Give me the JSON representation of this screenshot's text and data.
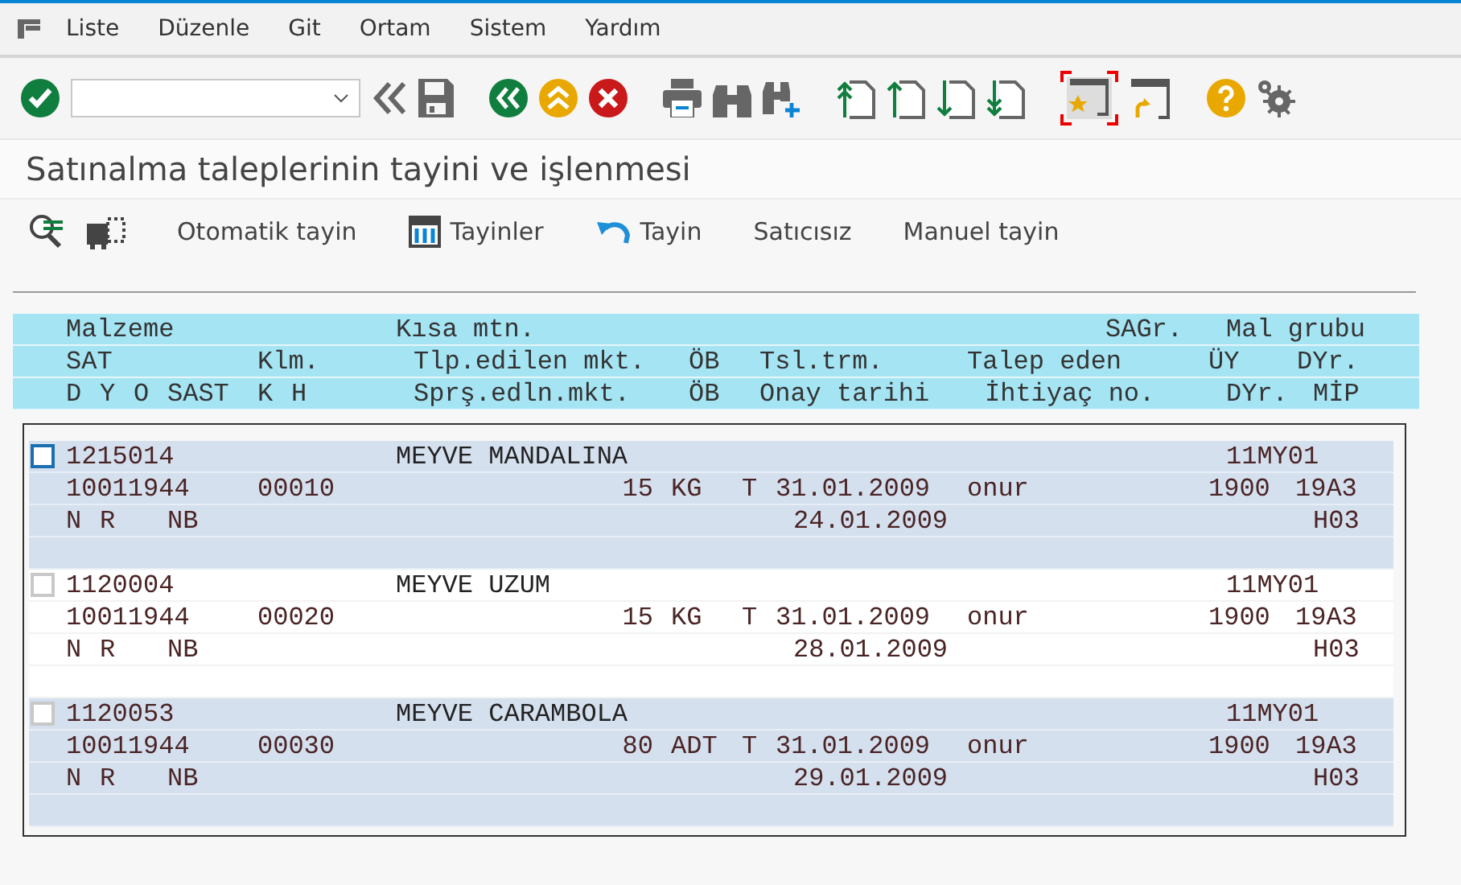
{
  "menu": [
    {
      "label": "Liste"
    },
    {
      "label": "Düzenle"
    },
    {
      "label": "Git"
    },
    {
      "label": "Ortam"
    },
    {
      "label": "Sistem"
    },
    {
      "label": "Yardım"
    }
  ],
  "title": "Satınalma taleplerinin tayini ve işlenmesi",
  "app_toolbar": [
    {
      "kind": "text",
      "label": "Otomatik tayin"
    },
    {
      "kind": "table",
      "label": "Tayinler"
    },
    {
      "kind": "undo",
      "label": "Tayin"
    },
    {
      "kind": "text",
      "label": "Satıcısız"
    },
    {
      "kind": "text",
      "label": "Manuel tayin"
    }
  ],
  "header": {
    "line_1": [
      "Malzeme",
      "Kısa mtn.",
      "SAGr.",
      "Mal grubu"
    ],
    "line_2": [
      "SAT",
      "Klm.",
      "Tlp.edilen mkt.",
      "ÖB",
      "Tsl.trm.",
      "Talep eden",
      "ÜY",
      "DYr."
    ],
    "line_3": [
      "D",
      "Y",
      "O",
      "SAST",
      "K",
      "H",
      "Sprş.edln.mkt.",
      "ÖB",
      "Onay tarihi",
      "İhtiyaç no.",
      "DYr.",
      "MİP"
    ]
  },
  "items": [
    {
      "focused": true,
      "malzeme": "1215014",
      "kisa_mtn": "MEYVE MANDALINA",
      "mal_grubu": "11MY01",
      "sat": "10011944",
      "klm": "00010",
      "quantity": "15",
      "ob": "KG",
      "date_type": "T",
      "delivery_date": "31.01.2009",
      "talep_eden": "onur",
      "uy": "1900",
      "dyr": "19A3",
      "d": "N",
      "y": "R",
      "sast": "NB",
      "onay_tarihi": "24.01.2009",
      "mip": "H03"
    },
    {
      "focused": false,
      "malzeme": "1120004",
      "kisa_mtn": "MEYVE UZUM",
      "mal_grubu": "11MY01",
      "sat": "10011944",
      "klm": "00020",
      "quantity": "15",
      "ob": "KG",
      "date_type": "T",
      "delivery_date": "31.01.2009",
      "talep_eden": "onur",
      "uy": "1900",
      "dyr": "19A3",
      "d": "N",
      "y": "R",
      "sast": "NB",
      "onay_tarihi": "28.01.2009",
      "mip": "H03"
    },
    {
      "focused": false,
      "malzeme": "1120053",
      "kisa_mtn": "MEYVE CARAMBOLA",
      "mal_grubu": "11MY01",
      "sat": "10011944",
      "klm": "00030",
      "quantity": "80",
      "ob": "ADT",
      "date_type": "T",
      "delivery_date": "31.01.2009",
      "talep_eden": "onur",
      "uy": "1900",
      "dyr": "19A3",
      "d": "N",
      "y": "R",
      "sast": "NB",
      "onay_tarihi": "29.01.2009",
      "mip": "H03"
    }
  ]
}
